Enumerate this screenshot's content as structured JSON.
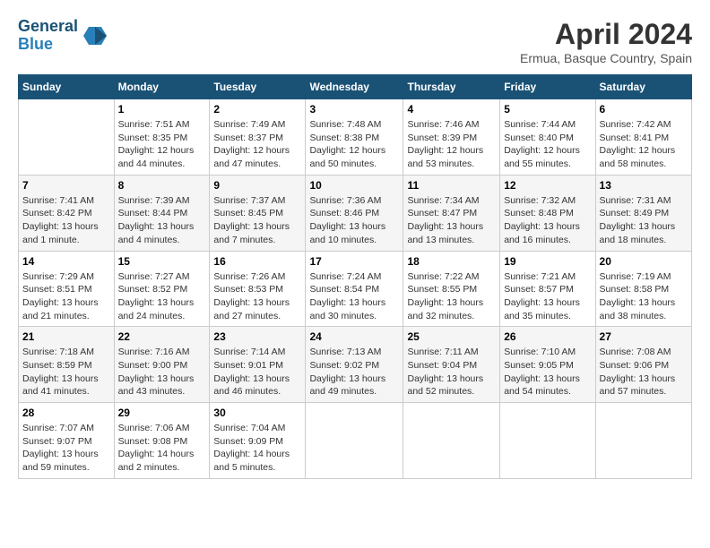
{
  "header": {
    "logo_line1": "General",
    "logo_line2": "Blue",
    "month_year": "April 2024",
    "location": "Ermua, Basque Country, Spain"
  },
  "columns": [
    "Sunday",
    "Monday",
    "Tuesday",
    "Wednesday",
    "Thursday",
    "Friday",
    "Saturday"
  ],
  "weeks": [
    [
      {
        "day": "",
        "info": ""
      },
      {
        "day": "1",
        "info": "Sunrise: 7:51 AM\nSunset: 8:35 PM\nDaylight: 12 hours\nand 44 minutes."
      },
      {
        "day": "2",
        "info": "Sunrise: 7:49 AM\nSunset: 8:37 PM\nDaylight: 12 hours\nand 47 minutes."
      },
      {
        "day": "3",
        "info": "Sunrise: 7:48 AM\nSunset: 8:38 PM\nDaylight: 12 hours\nand 50 minutes."
      },
      {
        "day": "4",
        "info": "Sunrise: 7:46 AM\nSunset: 8:39 PM\nDaylight: 12 hours\nand 53 minutes."
      },
      {
        "day": "5",
        "info": "Sunrise: 7:44 AM\nSunset: 8:40 PM\nDaylight: 12 hours\nand 55 minutes."
      },
      {
        "day": "6",
        "info": "Sunrise: 7:42 AM\nSunset: 8:41 PM\nDaylight: 12 hours\nand 58 minutes."
      }
    ],
    [
      {
        "day": "7",
        "info": "Sunrise: 7:41 AM\nSunset: 8:42 PM\nDaylight: 13 hours\nand 1 minute."
      },
      {
        "day": "8",
        "info": "Sunrise: 7:39 AM\nSunset: 8:44 PM\nDaylight: 13 hours\nand 4 minutes."
      },
      {
        "day": "9",
        "info": "Sunrise: 7:37 AM\nSunset: 8:45 PM\nDaylight: 13 hours\nand 7 minutes."
      },
      {
        "day": "10",
        "info": "Sunrise: 7:36 AM\nSunset: 8:46 PM\nDaylight: 13 hours\nand 10 minutes."
      },
      {
        "day": "11",
        "info": "Sunrise: 7:34 AM\nSunset: 8:47 PM\nDaylight: 13 hours\nand 13 minutes."
      },
      {
        "day": "12",
        "info": "Sunrise: 7:32 AM\nSunset: 8:48 PM\nDaylight: 13 hours\nand 16 minutes."
      },
      {
        "day": "13",
        "info": "Sunrise: 7:31 AM\nSunset: 8:49 PM\nDaylight: 13 hours\nand 18 minutes."
      }
    ],
    [
      {
        "day": "14",
        "info": "Sunrise: 7:29 AM\nSunset: 8:51 PM\nDaylight: 13 hours\nand 21 minutes."
      },
      {
        "day": "15",
        "info": "Sunrise: 7:27 AM\nSunset: 8:52 PM\nDaylight: 13 hours\nand 24 minutes."
      },
      {
        "day": "16",
        "info": "Sunrise: 7:26 AM\nSunset: 8:53 PM\nDaylight: 13 hours\nand 27 minutes."
      },
      {
        "day": "17",
        "info": "Sunrise: 7:24 AM\nSunset: 8:54 PM\nDaylight: 13 hours\nand 30 minutes."
      },
      {
        "day": "18",
        "info": "Sunrise: 7:22 AM\nSunset: 8:55 PM\nDaylight: 13 hours\nand 32 minutes."
      },
      {
        "day": "19",
        "info": "Sunrise: 7:21 AM\nSunset: 8:57 PM\nDaylight: 13 hours\nand 35 minutes."
      },
      {
        "day": "20",
        "info": "Sunrise: 7:19 AM\nSunset: 8:58 PM\nDaylight: 13 hours\nand 38 minutes."
      }
    ],
    [
      {
        "day": "21",
        "info": "Sunrise: 7:18 AM\nSunset: 8:59 PM\nDaylight: 13 hours\nand 41 minutes."
      },
      {
        "day": "22",
        "info": "Sunrise: 7:16 AM\nSunset: 9:00 PM\nDaylight: 13 hours\nand 43 minutes."
      },
      {
        "day": "23",
        "info": "Sunrise: 7:14 AM\nSunset: 9:01 PM\nDaylight: 13 hours\nand 46 minutes."
      },
      {
        "day": "24",
        "info": "Sunrise: 7:13 AM\nSunset: 9:02 PM\nDaylight: 13 hours\nand 49 minutes."
      },
      {
        "day": "25",
        "info": "Sunrise: 7:11 AM\nSunset: 9:04 PM\nDaylight: 13 hours\nand 52 minutes."
      },
      {
        "day": "26",
        "info": "Sunrise: 7:10 AM\nSunset: 9:05 PM\nDaylight: 13 hours\nand 54 minutes."
      },
      {
        "day": "27",
        "info": "Sunrise: 7:08 AM\nSunset: 9:06 PM\nDaylight: 13 hours\nand 57 minutes."
      }
    ],
    [
      {
        "day": "28",
        "info": "Sunrise: 7:07 AM\nSunset: 9:07 PM\nDaylight: 13 hours\nand 59 minutes."
      },
      {
        "day": "29",
        "info": "Sunrise: 7:06 AM\nSunset: 9:08 PM\nDaylight: 14 hours\nand 2 minutes."
      },
      {
        "day": "30",
        "info": "Sunrise: 7:04 AM\nSunset: 9:09 PM\nDaylight: 14 hours\nand 5 minutes."
      },
      {
        "day": "",
        "info": ""
      },
      {
        "day": "",
        "info": ""
      },
      {
        "day": "",
        "info": ""
      },
      {
        "day": "",
        "info": ""
      }
    ]
  ]
}
